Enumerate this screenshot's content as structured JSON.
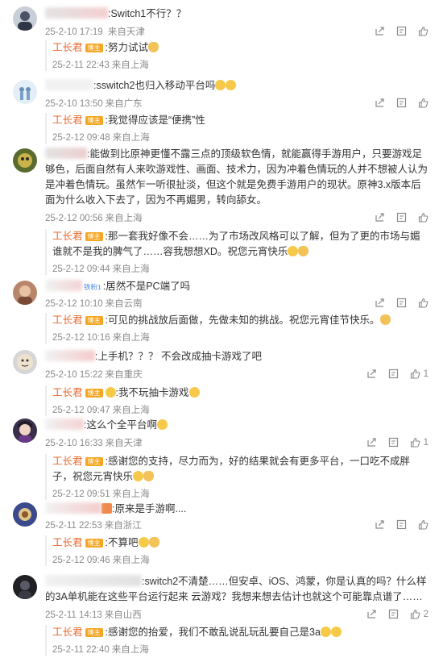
{
  "comments": [
    {
      "text": ":Switch1不行？？",
      "date": "25-2-10 17:19",
      "loc": "来自天津",
      "likes": "",
      "reply": {
        "name": "工长君",
        "badge": "博主",
        "text": ":努力试试",
        "date": "25-2-11 22:43",
        "loc": "来自上海"
      }
    },
    {
      "text": ":sswitch2也归入移动平台吗",
      "date": "25-2-10 13:50",
      "loc": "来自广东",
      "likes": "",
      "reply": {
        "name": "工长君",
        "badge": "博主",
        "text": ":我觉得应该是“便携”性",
        "date": "25-2-12 09:48",
        "loc": "来自上海"
      }
    },
    {
      "text": ":能做到比原神更懂不露三点的顶级软色情，就能赢得手游用户，只要游戏足够色，后面自然有人来吹游戏性、画面、技术力，因为冲着色情玩的人并不想被人认为是冲着色情玩。虽然乍一听很扯淡，但这个就是免费手游用户的现状。原神3.x版本后面为什么收入下去了，因为不再媚男，转向舔女。",
      "date": "25-2-12 00:56",
      "loc": "来自上海",
      "likes": "",
      "reply": {
        "name": "工长君",
        "badge": "博主",
        "text": ":那一套我好像不会……为了市场改风格可以了解，但为了更的市场与媚谁就不是我的脾气了……容我想想XD。祝您元宵快乐",
        "date": "25-2-12 09:44",
        "loc": "来自上海"
      }
    },
    {
      "text": ":居然不是PC端了吗",
      "date": "25-2-12 10:10",
      "loc": "来自云南",
      "likes": "",
      "tag": "铁粉1",
      "reply": {
        "name": "工长君",
        "badge": "博主",
        "text": ":可见的挑战放后面做，先做未知的挑战。祝您元宵佳节快乐。",
        "date": "25-2-12 10:16",
        "loc": "来自上海"
      }
    },
    {
      "text": ":上手机？？？ 不会改成抽卡游戏了吧",
      "date": "25-2-10 15:22",
      "loc": "来自重庆",
      "likes": "1",
      "reply": {
        "name": "工长君",
        "badge": "博主",
        "text": ":我不玩抽卡游戏",
        "date": "25-2-12 09:47",
        "loc": "来自上海"
      }
    },
    {
      "text": ":这么个全平台啊",
      "date": "25-2-10 16:33",
      "loc": "来自天津",
      "likes": "1",
      "reply": {
        "name": "工长君",
        "badge": "博主",
        "text": ":感谢您的支持，尽力而为，好的结果就会有更多平台，一口吃不成胖子，祝您元宵快乐",
        "date": "25-2-12 09:51",
        "loc": "来自上海"
      }
    },
    {
      "text": ":原来是手游啊....",
      "date": "25-2-11 22:53",
      "loc": "来自浙江",
      "likes": "",
      "reply": {
        "name": "工长君",
        "badge": "博主",
        "text": ":不算吧",
        "date": "25-2-12 09:46",
        "loc": "来自上海"
      }
    },
    {
      "text": ":switch2不清楚……但安卓、iOS、鸿蒙，你是认真的吗？什么样的3A单机能在这些平台运行起来 云游戏？我想来想去估计也就这个可能靠点谱了……",
      "date": "25-2-11 14:13",
      "loc": "来自山西",
      "likes": "2",
      "reply": {
        "name": "工长君",
        "badge": "博主",
        "text": ":感谢您的抬爱，我们不敢乱说乱玩乱要自己是3a",
        "date": "25-2-11 22:40",
        "loc": "来自上海"
      }
    }
  ],
  "icons": {
    "share": "share-icon",
    "comment": "comment-icon",
    "like": "like-icon"
  },
  "colors": {
    "reply_name": "#e8692f",
    "badge": "#f6a623",
    "meta": "#8a8a8a",
    "text": "#333333"
  }
}
